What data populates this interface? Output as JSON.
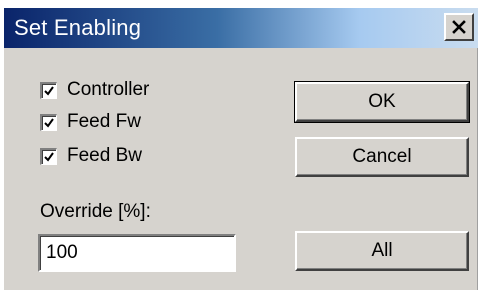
{
  "dialog": {
    "title": "Set Enabling",
    "close_icon": "close-x-icon"
  },
  "checkboxes": [
    {
      "label": "Controller",
      "checked": true
    },
    {
      "label": "Feed Fw",
      "checked": true
    },
    {
      "label": "Feed Bw",
      "checked": true
    }
  ],
  "override": {
    "label": "Override [%]:",
    "value": "100"
  },
  "buttons": {
    "ok": "OK",
    "cancel": "Cancel",
    "all": "All"
  },
  "colors": {
    "title_gradient_start": "#0a246a",
    "title_gradient_end": "#c9dcef",
    "dialog_face": "#d6d3ce"
  }
}
